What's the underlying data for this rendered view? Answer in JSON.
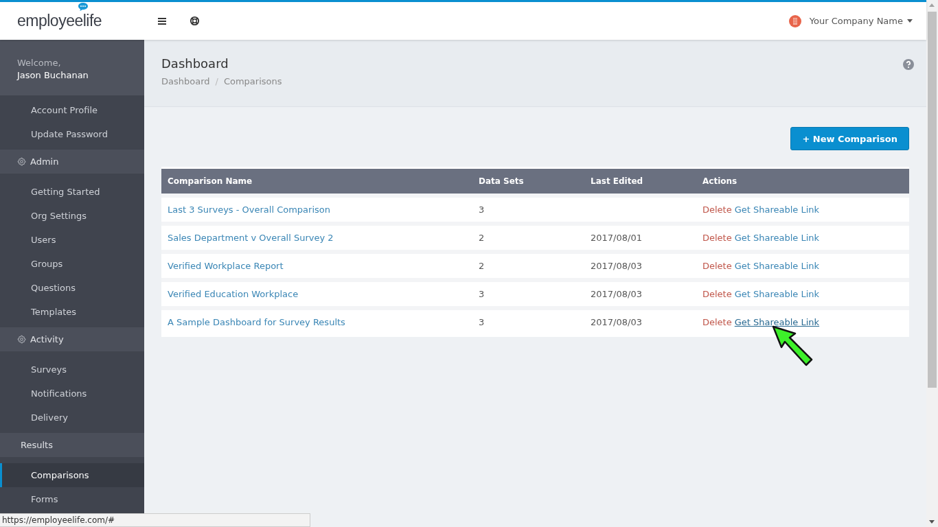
{
  "topbar": {
    "logo": "employeelife",
    "company": "Your Company Name"
  },
  "sidebar": {
    "welcome": "Welcome,",
    "user": "Jason Buchanan",
    "items": [
      {
        "kind": "link",
        "label": "Account Profile",
        "selected": false
      },
      {
        "kind": "link",
        "label": "Update Password",
        "selected": false
      },
      {
        "kind": "heading",
        "label": "Admin"
      },
      {
        "kind": "link",
        "label": "Getting Started",
        "selected": false
      },
      {
        "kind": "link",
        "label": "Org Settings",
        "selected": false
      },
      {
        "kind": "link",
        "label": "Users",
        "selected": false
      },
      {
        "kind": "link",
        "label": "Groups",
        "selected": false
      },
      {
        "kind": "link",
        "label": "Questions",
        "selected": false
      },
      {
        "kind": "link",
        "label": "Templates",
        "selected": false
      },
      {
        "kind": "heading",
        "label": "Activity"
      },
      {
        "kind": "link",
        "label": "Surveys",
        "selected": false
      },
      {
        "kind": "link",
        "label": "Notifications",
        "selected": false
      },
      {
        "kind": "link",
        "label": "Delivery",
        "selected": false
      },
      {
        "kind": "label",
        "label": "Results"
      },
      {
        "kind": "link",
        "label": "Comparisons",
        "selected": true
      },
      {
        "kind": "link",
        "label": "Forms",
        "selected": false
      }
    ]
  },
  "page": {
    "title": "Dashboard",
    "breadcrumb": [
      "Dashboard",
      "Comparisons"
    ],
    "breadcrumb_separator": "/"
  },
  "new_button": "+ New Comparison",
  "table": {
    "columns": [
      "Comparison Name",
      "Data Sets",
      "Last Edited",
      "Actions"
    ],
    "rows": [
      {
        "name": "Last 3 Surveys - Overall Comparison",
        "data_sets": "3",
        "delete": "Delete",
        "share": "Get Shareable Link",
        "hovered": false
      },
      {
        "name": "Sales Department v Overall Survey 2",
        "data_sets": "2",
        "last_edited": "2017/08/01",
        "delete": "Delete",
        "share": "Get Shareable Link",
        "hovered": false
      },
      {
        "name": "Verified Workplace Report",
        "data_sets": "2",
        "last_edited": "2017/08/03",
        "delete": "Delete",
        "share": "Get Shareable Link",
        "hovered": false
      },
      {
        "name": "Verified Education Workplace",
        "data_sets": "3",
        "last_edited": "2017/08/03",
        "delete": "Delete",
        "share": "Get Shareable Link",
        "hovered": false
      },
      {
        "name": "A Sample Dashboard for Survey Results",
        "data_sets": "3",
        "last_edited": "2017/08/03",
        "delete": "Delete",
        "share": "Get Shareable Link",
        "hovered": true
      }
    ]
  },
  "status_bar": "https://employeelife.com/#"
}
